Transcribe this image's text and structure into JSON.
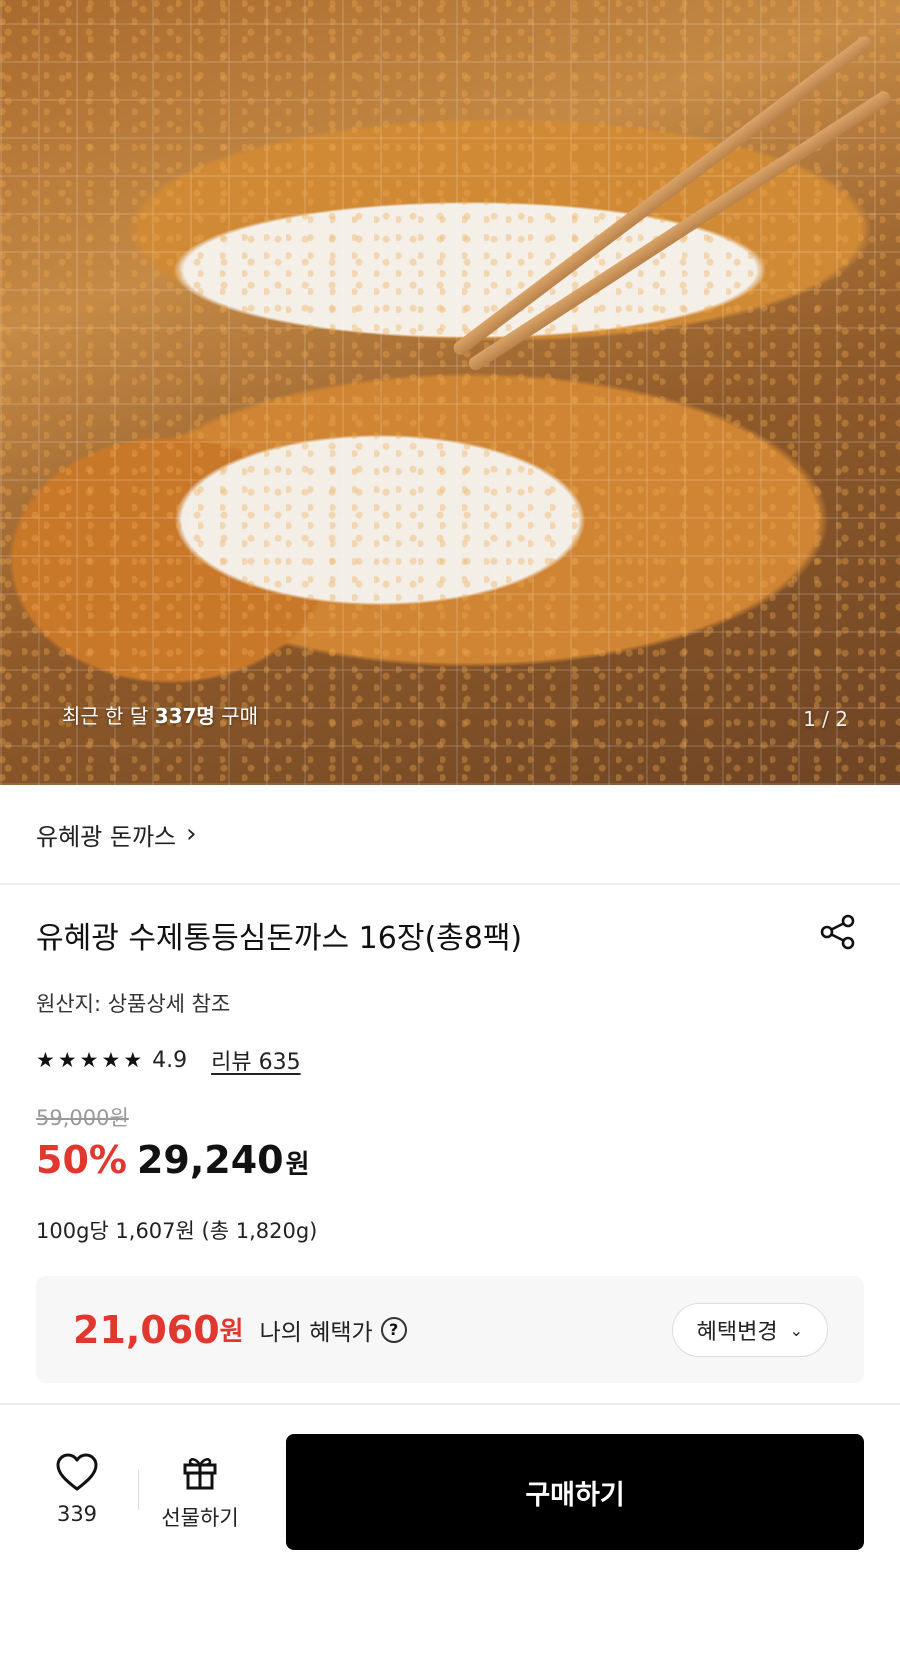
{
  "hero": {
    "recent_prefix": "최근 한 달 ",
    "recent_count": "337명",
    "recent_suffix": " 구매",
    "pager": "1 / 2",
    "image_alt": "돈까스"
  },
  "brand": {
    "name": "유혜광 돈까스"
  },
  "product": {
    "title": "유혜광 수제통등심돈까스 16장(총8팩)",
    "origin": "원산지: 상품상세 참조",
    "rating": "4.9",
    "stars": 5,
    "review_label": "리뷰 635",
    "original_price": "59,000원",
    "discount": "50%",
    "price": "29,240",
    "price_unit": "원",
    "unit_price": "100g당 1,607원 (총 1,820g)"
  },
  "benefit": {
    "price": "21,060",
    "price_unit": "원",
    "label": "나의 혜택가",
    "help_icon": "?",
    "change_button": "혜택변경"
  },
  "bottom_bar": {
    "like_count": "339",
    "gift_label": "선물하기",
    "buy_label": "구매하기"
  },
  "colors": {
    "accent_red": "#e0382e",
    "buy_button": "#000000"
  }
}
